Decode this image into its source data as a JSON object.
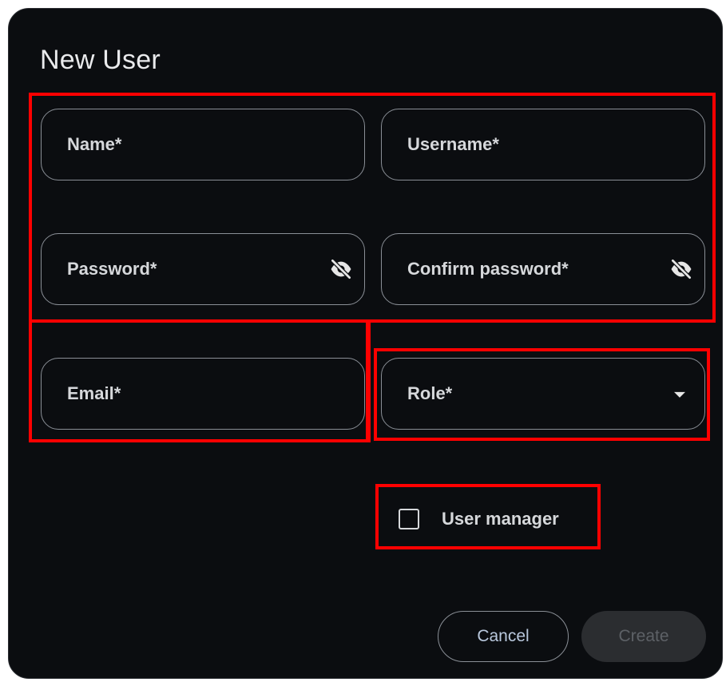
{
  "dialog": {
    "title": "New User"
  },
  "form": {
    "name_label": "Name*",
    "username_label": "Username*",
    "password_label": "Password*",
    "confirm_password_label": "Confirm password*",
    "email_label": "Email*",
    "role_label": "Role*",
    "password_visibility_icon": "eye-off-icon",
    "role_dropdown_icon": "caret-down-icon"
  },
  "options": {
    "user_manager_label": "User manager",
    "user_manager_checked": false
  },
  "actions": {
    "cancel_label": "Cancel",
    "create_label": "Create",
    "create_enabled": false
  },
  "colors": {
    "background": "#0b0d10",
    "field_border": "#8a8f96",
    "text": "#d6d8db",
    "highlight": "#ff0000",
    "create_disabled_bg": "#2b2d30"
  }
}
